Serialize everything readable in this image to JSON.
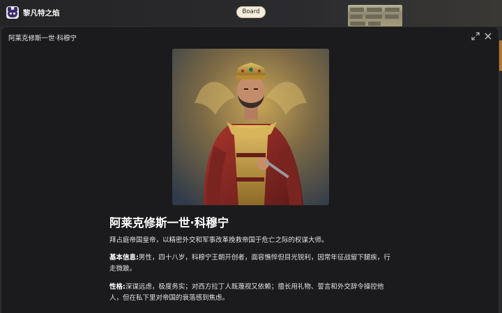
{
  "header": {
    "app_title": "黎凡特之焰",
    "board_label": "Board"
  },
  "modal": {
    "title": "阿莱克修斯一世·科穆宁",
    "heading": "阿莱克修斯一世·科穆宁",
    "lead": "拜占庭帝国皇帝，以精密外交和军事改革挽救帝国于危亡之际的权谋大师。",
    "basic_label": "基本信息:",
    "basic_text": "男性，四十八岁，科穆宁王朝开创者，面容憔悴但目光锐利，因常年征战留下腿疾，行走微跛。",
    "personality_label": "性格:",
    "personality_text": "深谋远虑，极度务实；对西方拉丁人既蔑视又依赖；擅长用礼物、誓言和外交辞令操控他人，但在私下里对帝国的衰落感到焦虑。"
  },
  "colors": {
    "accent_gold": "#c9a24a",
    "robe_red": "#8e2a25",
    "modal_bg": "#1b1b1d"
  }
}
